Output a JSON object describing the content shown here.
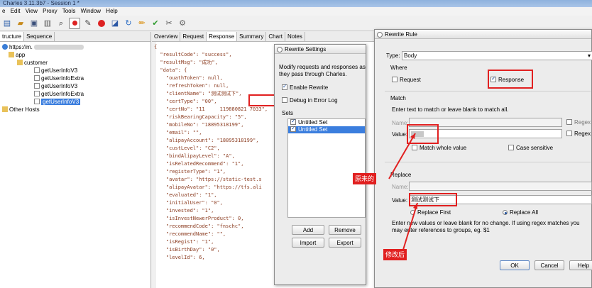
{
  "window": {
    "title": "Charles 3.11.3b7 - Session 1 *"
  },
  "menu": [
    "e",
    "Edit",
    "View",
    "Proxy",
    "Tools",
    "Window",
    "Help"
  ],
  "toolbar_icons": [
    "new-session-icon",
    "open-icon",
    "save-icon",
    "trash-icon",
    "binoculars-icon",
    "record-icon",
    "throttle-icon",
    "breakpoint-icon",
    "compose-icon",
    "refresh-icon",
    "edit-icon",
    "tick-icon",
    "tools-icon",
    "settings-icon"
  ],
  "left_panel": {
    "tabs": [
      "tructure",
      "Sequence"
    ],
    "tree": [
      "https://m.",
      "app",
      "customer",
      "getUserInfoV3",
      "getUserInfoExtra",
      "getUserInfoV3",
      "getUserInfoExtra",
      "getUserInfoV3",
      "Other Hosts"
    ]
  },
  "right_panel": {
    "tabs": [
      "Overview",
      "Request",
      "Response",
      "Summary",
      "Chart",
      "Notes"
    ],
    "json_lines": [
      "{",
      "  \"resultCode\": \"success\",",
      "  \"resultMsg\": \"成功\",",
      "  \"data\": {",
      "    \"ouathToken\": null,",
      "    \"refreshToken\": null,",
      "    \"clientName\": \"测试测试下\",",
      "    \"certType\": \"00\",",
      "    \"certNo\": \"11　　　119880821 7033\",",
      "    \"riskBearingCapacity\": \"5\",",
      "    \"mobileNo\": \"18895318199\",",
      "    \"email\": \"\",",
      "    \"alipayAccount\": \"18895318199\",",
      "    \"custLevel\": \"C2\",",
      "    \"bindAlipayLevel\": \"A\",",
      "    \"isRelatedRecommend\": \"1\",",
      "    \"registerType\": \"1\",",
      "    \"avatar\": \"https://static-test.s",
      "    \"alipayAvatar\": \"https://tfs.ali",
      "    \"evaluated\": \"1\",",
      "    \"initialUser\": \"0\",",
      "    \"invested\": \"1\",",
      "    \"isInvestNewerProduct\": 0,",
      "    \"recommendCode\": \"fnschc\",",
      "    \"recommendName\": \"\",",
      "    \"isRegist\": \"1\",",
      "    \"isBirthDay\": \"0\",",
      "    \"levelId\": 6,"
    ]
  },
  "rewrite_settings": {
    "title": "Rewrite Settings",
    "description": "Modify requests and responses as they pass through Charles.",
    "enable_label": "Enable Rewrite",
    "enable_checked": true,
    "debug_label": "Debug in Error Log",
    "debug_checked": false,
    "sets_label": "Sets",
    "sets": [
      {
        "name": "Untitled Set",
        "checked": true,
        "selected": false
      },
      {
        "name": "Untitled Set",
        "checked": true,
        "selected": true
      }
    ],
    "add": "Add",
    "remove": "Remove",
    "import": "Import",
    "export": "Export"
  },
  "rewrite_rule": {
    "title": "Rewrite Rule",
    "type_label": "Type:",
    "type_value": "Body",
    "where_label": "Where",
    "request_label": "Request",
    "request_checked": false,
    "response_label": "Response",
    "response_checked": true,
    "match_label": "Match",
    "match_hint": "Enter text to match or leave blank to match all.",
    "name_label": "Name:",
    "value_label": "Value:",
    "regex_label": "Regex",
    "match_whole_label": "Match whole value",
    "case_label": "Case sensitive",
    "replace_label": "Replace",
    "replace_name_label": "Name:",
    "replace_value_label": "Value:",
    "replace_value": "测试测试下",
    "replace_first": "Replace First",
    "replace_all": "Replace All",
    "replace_all_selected": true,
    "replace_hint": "Enter new values or leave blank for no change. If using regex matches you may enter references to groups, eg. $1",
    "ok": "OK",
    "cancel": "Cancel",
    "help": "Help"
  },
  "annotations": {
    "original": "原来的",
    "modified": "修改后"
  },
  "colors": {
    "highlight": "#e12020",
    "selection": "#3b7ede",
    "json_text": "#8b3b1f"
  }
}
